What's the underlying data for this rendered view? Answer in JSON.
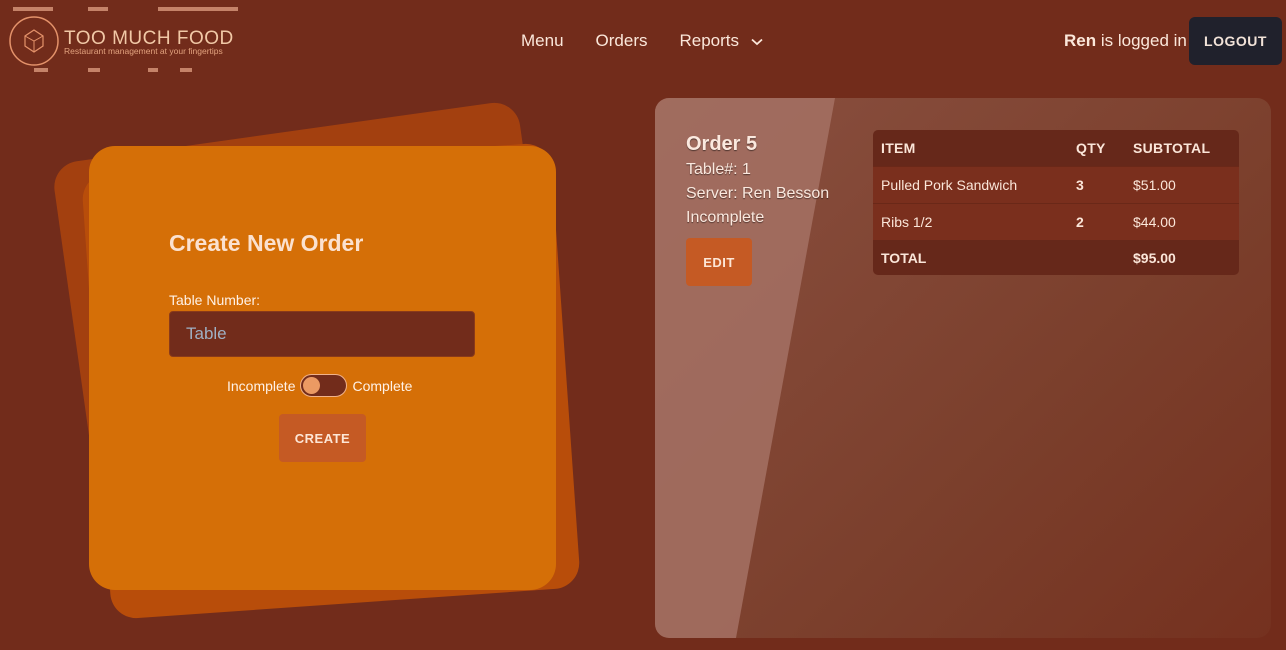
{
  "header": {
    "brand": "TOO MUCH FOOD",
    "tagline": "Restaurant management at your fingertips",
    "nav": [
      {
        "label": "Menu"
      },
      {
        "label": "Orders"
      },
      {
        "label": "Reports"
      }
    ],
    "user_name": "Ren",
    "user_status_suffix": " is logged in",
    "logout_label": "LOGOUT"
  },
  "create_form": {
    "title": "Create New Order",
    "table_label": "Table Number:",
    "table_placeholder": "Table",
    "toggle_off_label": "Incomplete",
    "toggle_on_label": "Complete",
    "create_label": "CREATE"
  },
  "order": {
    "title": "Order 5",
    "table_line": "Table#: 1",
    "server_line": "Server: Ren Besson",
    "status": "Incomplete",
    "edit_label": "EDIT",
    "columns": [
      "ITEM",
      "QTY",
      "SUBTOTAL"
    ],
    "items": [
      {
        "item": "Pulled Pork Sandwich",
        "qty": "3",
        "subtotal": "$51.00"
      },
      {
        "item": "Ribs 1/2",
        "qty": "2",
        "subtotal": "$44.00"
      }
    ],
    "total_label": "TOTAL",
    "total_value": "$95.00"
  },
  "colors": {
    "background": "#722c1b",
    "card": "#d56f07",
    "button": "#c55a24",
    "logout_button": "#20212c"
  }
}
